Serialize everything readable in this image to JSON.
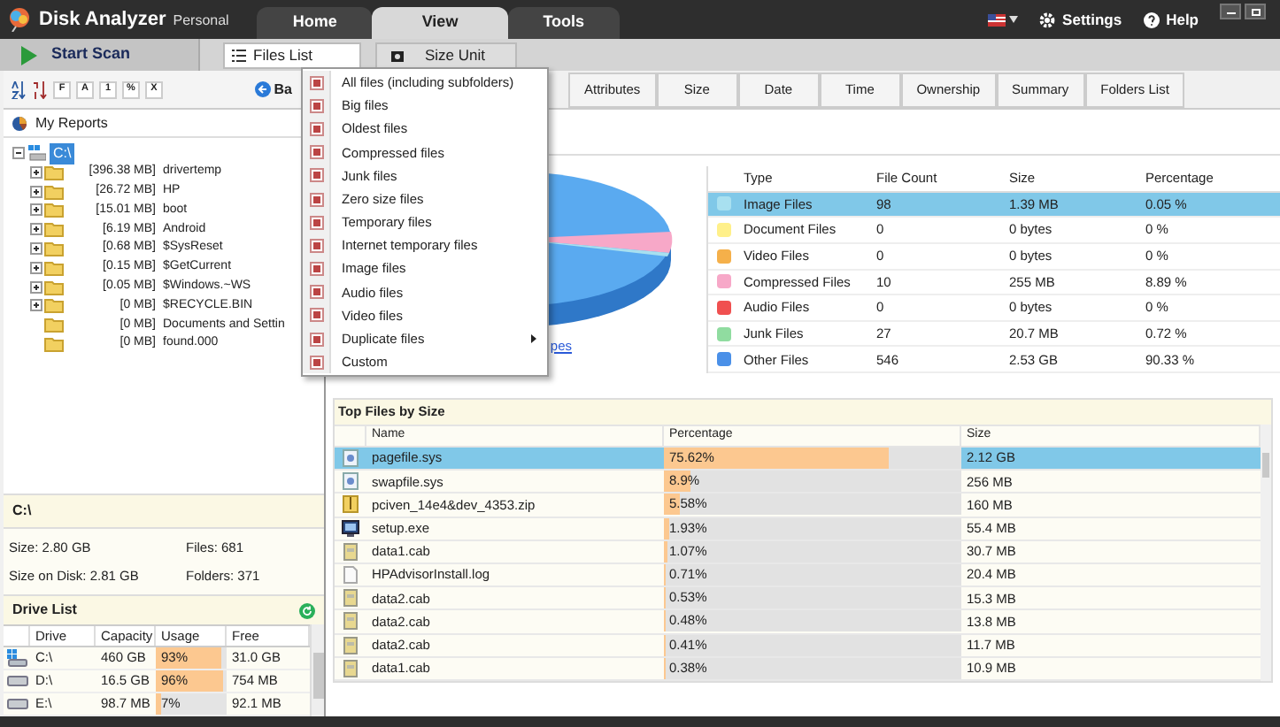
{
  "app": {
    "name": "Disk Analyzer",
    "edition": "Personal"
  },
  "menu_tabs": [
    {
      "label": "Home",
      "selected": false
    },
    {
      "label": "View",
      "selected": true
    },
    {
      "label": "Tools",
      "selected": false
    }
  ],
  "header_links": [
    {
      "kind": "settings",
      "label": "Settings"
    },
    {
      "kind": "help",
      "label": "Help"
    }
  ],
  "ribbon": {
    "start_scan": "Start Scan",
    "files_list": "Files List",
    "size_unit": "Size Unit"
  },
  "sort_buttons": [
    "F",
    "A",
    "1",
    "%",
    "X"
  ],
  "back_button": "Ba",
  "reports_title": "My Reports",
  "tree": {
    "label": "C:\\",
    "expanded": true,
    "children": [
      {
        "size": "[396.38 MB]",
        "name": "drivertemp",
        "expandable": true
      },
      {
        "size": "[26.72 MB]",
        "name": "HP",
        "expandable": true
      },
      {
        "size": "[15.01 MB]",
        "name": "boot",
        "expandable": true
      },
      {
        "size": "[6.19 MB]",
        "name": "Android",
        "expandable": true
      },
      {
        "size": "[0.68 MB]",
        "name": "$SysReset",
        "expandable": true
      },
      {
        "size": "[0.15 MB]",
        "name": "$GetCurrent",
        "expandable": true
      },
      {
        "size": "[0.05 MB]",
        "name": "$Windows.~WS",
        "expandable": true
      },
      {
        "size": "[0 MB]",
        "name": "$RECYCLE.BIN",
        "expandable": true
      },
      {
        "size": "[0 MB]",
        "name": "Documents and Settin",
        "expandable": false
      },
      {
        "size": "[0 MB]",
        "name": "found.000",
        "expandable": false
      }
    ]
  },
  "folder_info": {
    "path": "C:\\",
    "size": "Size: 2.80 GB",
    "files": "Files: 681",
    "size_on_disk": "Size on Disk: 2.81 GB",
    "folders": "Folders: 371"
  },
  "drive_list": {
    "title": "Drive List",
    "columns": [
      "Drive",
      "Capacity",
      "Usage",
      "Free"
    ],
    "rows": [
      {
        "kind": "system",
        "drive": "C:\\",
        "capacity": "460 GB",
        "usage": "93%",
        "level": 0.93,
        "free": "31.0 GB"
      },
      {
        "kind": "drive",
        "drive": "D:\\",
        "capacity": "16.5 GB",
        "usage": "96%",
        "level": 0.96,
        "free": "754 MB"
      },
      {
        "kind": "drive",
        "drive": "E:\\",
        "capacity": "98.7 MB",
        "usage": "7%",
        "level": 0.07,
        "free": "92.1 MB"
      }
    ]
  },
  "view_tabs": [
    "Attributes",
    "Size",
    "Date",
    "Time",
    "Ownership",
    "Summary",
    "Folders List"
  ],
  "pie_link": "pes",
  "file_types": {
    "columns": [
      "Type",
      "File Count",
      "Size",
      "Percentage"
    ],
    "rows": [
      {
        "type": "Image Files",
        "count": "98",
        "size": "1.39 MB",
        "percentage": "0.05 %",
        "color": "#a8e0f0",
        "selected": true
      },
      {
        "type": "Document Files",
        "count": "0",
        "size": "0 bytes",
        "percentage": "0 %",
        "color": "#fff08a",
        "selected": false
      },
      {
        "type": "Video Files",
        "count": "0",
        "size": "0 bytes",
        "percentage": "0 %",
        "color": "#f5b04a",
        "selected": false
      },
      {
        "type": "Compressed Files",
        "count": "10",
        "size": "255 MB",
        "percentage": "8.89 %",
        "color": "#f7a8c8",
        "selected": false
      },
      {
        "type": "Audio Files",
        "count": "0",
        "size": "0 bytes",
        "percentage": "0 %",
        "color": "#f05050",
        "selected": false
      },
      {
        "type": "Junk Files",
        "count": "27",
        "size": "20.7 MB",
        "percentage": "0.72 %",
        "color": "#90dca0",
        "selected": false
      },
      {
        "type": "Other Files",
        "count": "546",
        "size": "2.53 GB",
        "percentage": "90.33 %",
        "color": "#4a90e8",
        "selected": false
      }
    ]
  },
  "top_files": {
    "title": "Top Files by Size",
    "columns": [
      "Name",
      "Percentage",
      "Size"
    ],
    "rows": [
      {
        "kind": "system",
        "name": "pagefile.sys",
        "percentage": "75.62%",
        "level": 0.7562,
        "size": "2.12 GB",
        "selected": true
      },
      {
        "kind": "system",
        "name": "swapfile.sys",
        "percentage": "8.9%",
        "level": 0.089,
        "size": "256 MB",
        "selected": false
      },
      {
        "kind": "zip",
        "name": "pciven_14e4&dev_4353.zip",
        "percentage": "5.58%",
        "level": 0.0558,
        "size": "160 MB",
        "selected": false
      },
      {
        "kind": "exe",
        "name": "setup.exe",
        "percentage": "1.93%",
        "level": 0.0193,
        "size": "55.4 MB",
        "selected": false
      },
      {
        "kind": "cab",
        "name": "data1.cab",
        "percentage": "1.07%",
        "level": 0.0107,
        "size": "30.7 MB",
        "selected": false
      },
      {
        "kind": "log",
        "name": "HPAdvisorInstall.log",
        "percentage": "0.71%",
        "level": 0.0071,
        "size": "20.4 MB",
        "selected": false
      },
      {
        "kind": "cab",
        "name": "data2.cab",
        "percentage": "0.53%",
        "level": 0.0053,
        "size": "15.3 MB",
        "selected": false
      },
      {
        "kind": "cab",
        "name": "data2.cab",
        "percentage": "0.48%",
        "level": 0.0048,
        "size": "13.8 MB",
        "selected": false
      },
      {
        "kind": "cab",
        "name": "data2.cab",
        "percentage": "0.41%",
        "level": 0.0041,
        "size": "11.7 MB",
        "selected": false
      },
      {
        "kind": "cab",
        "name": "data1.cab",
        "percentage": "0.38%",
        "level": 0.0038,
        "size": "10.9 MB",
        "selected": false
      }
    ]
  },
  "files_menu": [
    {
      "label": "All files (including subfolders)",
      "submenu": false
    },
    {
      "label": "Big files",
      "submenu": false
    },
    {
      "label": "Oldest files",
      "submenu": false
    },
    {
      "label": "Compressed files",
      "submenu": false
    },
    {
      "label": "Junk files",
      "submenu": false
    },
    {
      "label": "Zero size files",
      "submenu": false
    },
    {
      "label": "Temporary files",
      "submenu": false
    },
    {
      "label": "Internet temporary files",
      "submenu": false
    },
    {
      "label": "Image files",
      "submenu": false
    },
    {
      "label": "Audio files",
      "submenu": false
    },
    {
      "label": "Video files",
      "submenu": false
    },
    {
      "label": "Duplicate files",
      "submenu": true
    },
    {
      "label": "Custom",
      "submenu": false
    }
  ]
}
